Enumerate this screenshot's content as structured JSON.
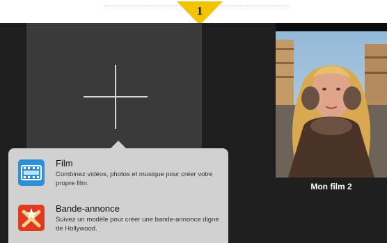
{
  "step_marker": {
    "number": "1",
    "color": "#f2c400"
  },
  "new_project": {
    "icon": "plus-icon"
  },
  "project": {
    "title": "Mon film 2",
    "thumbnail": "woman-in-earmuffs-photo"
  },
  "popover": {
    "items": [
      {
        "icon": "film-strip-icon",
        "title": "Film",
        "description": "Combinez vidéos, photos et musique pour créer votre propre film."
      },
      {
        "icon": "clapperboard-star-icon",
        "title": "Bande-annonce",
        "description": "Suivez un modèle pour créer une bande-annonce digne de Hollywood."
      }
    ]
  },
  "colors": {
    "app_bg": "#1e1e1e",
    "tile_bg": "#3a3a3a",
    "popover_bg": "#d1d1d1",
    "film_icon": "#2d8fd6",
    "trailer_icon": "#e03a22"
  }
}
